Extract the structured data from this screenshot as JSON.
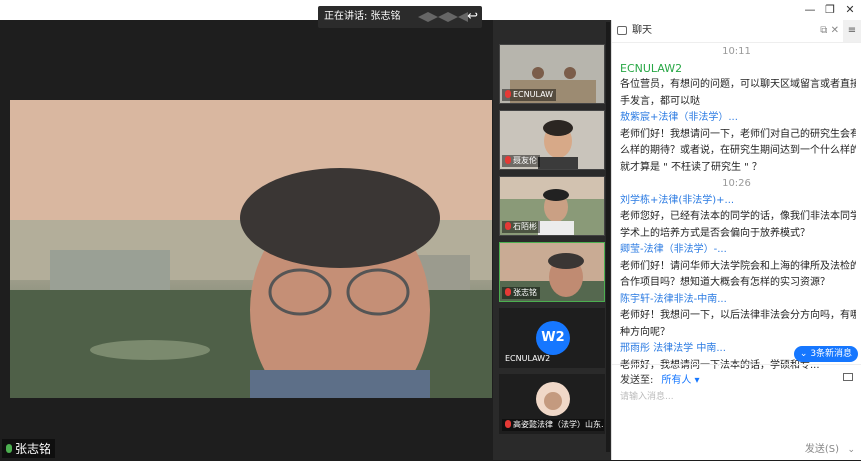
{
  "window": {
    "minimize": "—",
    "restore": "❐",
    "close": "✕"
  },
  "speaking": {
    "label": "正在讲话: 张志铭"
  },
  "main": {
    "speaker_name": "张志铭"
  },
  "thumbs": [
    {
      "label": "ECNULAW"
    },
    {
      "label": "聂友伦"
    },
    {
      "label": "石陌彬"
    },
    {
      "label": "张志铭"
    },
    {
      "label": "ECNULAW2",
      "avatar": "W2"
    },
    {
      "label": "高姿懿法律（法学）山东..."
    }
  ],
  "chat": {
    "title": "聊天",
    "lines": [
      {
        "kind": "time",
        "text": "10:11"
      },
      {
        "kind": "sender-green",
        "text": "ECNULAW2"
      },
      {
        "kind": "text",
        "text": "各位营员，有想问的问题，可以聊天区域留言或者直接举"
      },
      {
        "kind": "text",
        "text": "手发言，都可以哒"
      },
      {
        "kind": "sender",
        "text": "敖紫宸+法律（非法学）..."
      },
      {
        "kind": "text",
        "text": "老师们好！我想请问一下，老师们对自己的研究生会有什"
      },
      {
        "kind": "text",
        "text": "么样的期待？或者说，在研究生期间达到一个什么样的成"
      },
      {
        "kind": "text",
        "text": "就才算是 \" 不枉读了研究生 \" ？"
      },
      {
        "kind": "time",
        "text": "10:26"
      },
      {
        "kind": "sender",
        "text": "刘学栋+法律(非法学)+..."
      },
      {
        "kind": "text",
        "text": "老师您好，已经有法本的同学的话，像我们非法本同学在"
      },
      {
        "kind": "text",
        "text": "学术上的培养方式是否会偏向于放养模式？"
      },
      {
        "kind": "sender",
        "text": "卿莹-法律（非法学）-..."
      },
      {
        "kind": "text",
        "text": "老师们好！请问华师大法学院会和上海的律所及法检的"
      },
      {
        "kind": "text",
        "text": "合作项目吗？想知道大概会有怎样的实习资源？"
      },
      {
        "kind": "sender",
        "text": "陈宇轩-法律非法-中南..."
      },
      {
        "kind": "text",
        "text": "老师好！我想问一下，以后法律非法会分方向吗，有哪儿"
      },
      {
        "kind": "text",
        "text": "种方向呢？"
      },
      {
        "kind": "sender",
        "text": "邢雨彤 法律法学 中南..."
      },
      {
        "kind": "text",
        "text": "老师好，我想请问一下法本的话，学硕和专..."
      }
    ],
    "new_messages": "3条新消息",
    "send_to_label": "发送至:",
    "send_to_value": "所有人 ▾",
    "input_placeholder": "请输入消息...",
    "send_label": "发送(S)",
    "send_dropdown": "⌄"
  }
}
